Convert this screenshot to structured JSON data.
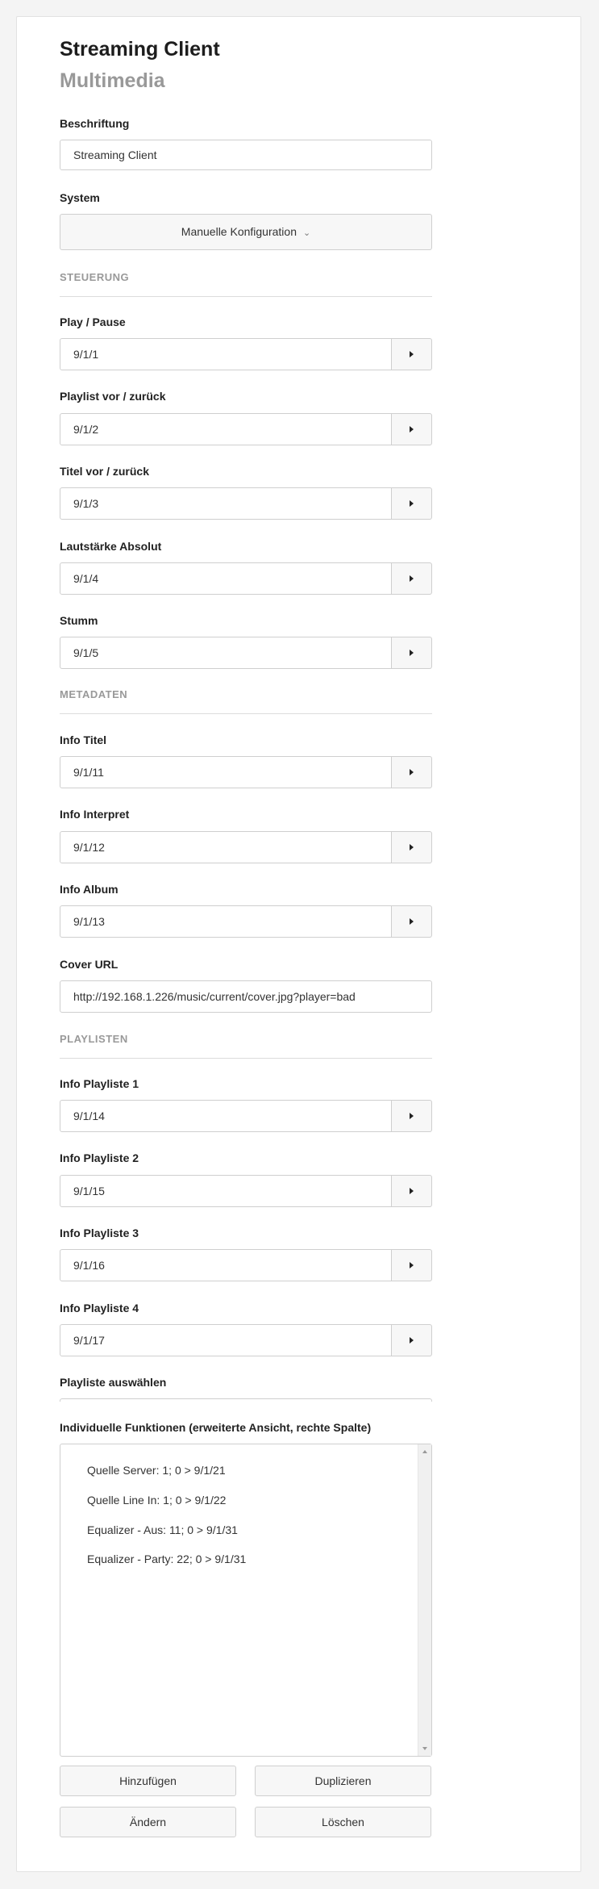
{
  "header": {
    "title": "Streaming Client",
    "subtitle": "Multimedia"
  },
  "beschriftung": {
    "label": "Beschriftung",
    "value": "Streaming Client"
  },
  "system": {
    "label": "System",
    "value": "Manuelle Konfiguration"
  },
  "sections": {
    "steuerung": "STEUERUNG",
    "metadaten": "METADATEN",
    "playlisten": "PLAYLISTEN"
  },
  "fields": {
    "play_pause": {
      "label": "Play / Pause",
      "value": "9/1/1"
    },
    "playlist": {
      "label": "Playlist vor / zurück",
      "value": "9/1/2"
    },
    "titel": {
      "label": "Titel vor / zurück",
      "value": "9/1/3"
    },
    "lautstaerke": {
      "label": "Lautstärke Absolut",
      "value": "9/1/4"
    },
    "stumm": {
      "label": "Stumm",
      "value": "9/1/5"
    },
    "info_titel": {
      "label": "Info Titel",
      "value": "9/1/11"
    },
    "info_interpret": {
      "label": "Info Interpret",
      "value": "9/1/12"
    },
    "info_album": {
      "label": "Info Album",
      "value": "9/1/13"
    },
    "info_playliste_1": {
      "label": "Info Playliste 1",
      "value": "9/1/14"
    },
    "info_playliste_2": {
      "label": "Info Playliste 2",
      "value": "9/1/15"
    },
    "info_playliste_3": {
      "label": "Info Playliste 3",
      "value": "9/1/16"
    },
    "info_playliste_4": {
      "label": "Info Playliste 4",
      "value": "9/1/17"
    }
  },
  "cover": {
    "label": "Cover URL",
    "value": "http://192.168.1.226/music/current/cover.jpg?player=bad"
  },
  "playliste_auswaehlen": {
    "label": "Playliste auswählen"
  },
  "funktionen": {
    "label": "Individuelle Funktionen (erweiterte Ansicht, rechte Spalte)",
    "items": [
      "Quelle Server: 1; 0 > 9/1/21",
      "Quelle Line In: 1; 0 > 9/1/22",
      "Equalizer - Aus: 11; 0 > 9/1/31",
      "Equalizer - Party: 22; 0 > 9/1/31"
    ]
  },
  "buttons": {
    "add": "Hinzufügen",
    "duplicate": "Duplizieren",
    "change": "Ändern",
    "delete": "Löschen"
  },
  "icons": {
    "chevron": "chevron-down-icon",
    "go": "triangle-right-icon"
  }
}
